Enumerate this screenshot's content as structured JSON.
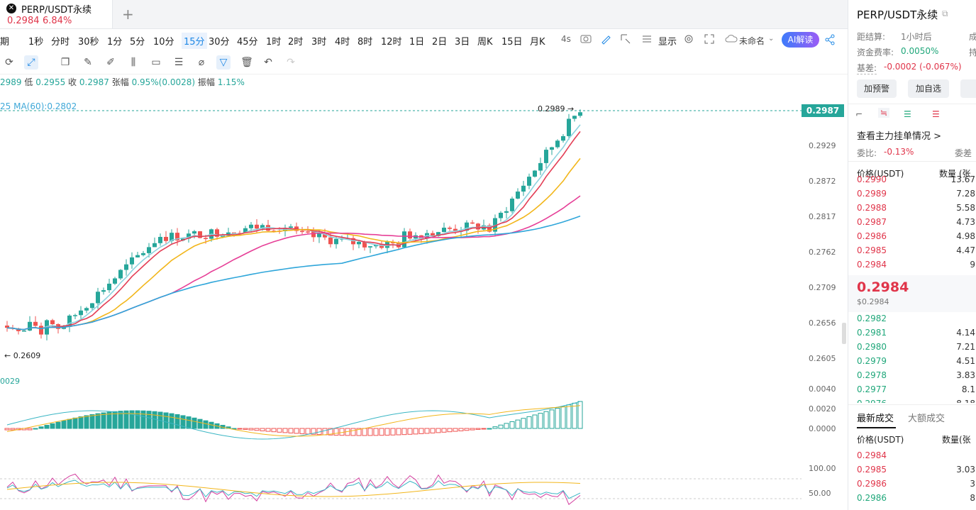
{
  "tab": {
    "symbol": "PERP/USDT永续",
    "price": "0.2984",
    "change": "6.84%"
  },
  "intervals": [
    "期",
    "1秒",
    "分时",
    "30秒",
    "1分",
    "5分",
    "10分",
    "15分",
    "30分",
    "45分",
    "1时",
    "2时",
    "3时",
    "4时",
    "8时",
    "12时",
    "1日",
    "2日",
    "3日",
    "周K",
    "15日",
    "月K",
    "4s"
  ],
  "active_interval": "15分",
  "toolbar_right": {
    "display": "显示",
    "layout": "未命名",
    "ai": "AI解读"
  },
  "ohlc": {
    "high": "2989",
    "low_label": "低",
    "low": "0.2955",
    "close_label": "收",
    "close": "0.2987",
    "amp_label": "张幅",
    "amp": "0.95%(0.0028)",
    "osc_label": "振幅",
    "osc": "1.15%"
  },
  "ma_legend": "25  MA(60):0.2802",
  "annotations": {
    "high": "0.2989",
    "low": "0.2609",
    "macd": "0029"
  },
  "price_axis": [
    "0.2929",
    "0.2872",
    "0.2817",
    "0.2762",
    "0.2709",
    "0.2656",
    "0.2605"
  ],
  "current_price_tag": "0.2987",
  "macd_axis": [
    "0.0040",
    "0.0020",
    "0.0000"
  ],
  "rsi_axis": [
    "100.00",
    "50.00"
  ],
  "colors": {
    "up": "#26a69a",
    "down": "#ef5350",
    "accent": "#1e88e5"
  },
  "sidebar": {
    "symbol": "PERP/USDT永续",
    "settle_label": "距结算:",
    "settle_value": "1小时后",
    "settle_right": "成",
    "fund_label": "资金费率:",
    "fund_value": "0.0050%",
    "fund_right": "持",
    "basis_label": "基差:",
    "basis_value": "-0.0002 (-0.067%)",
    "btn_alert": "加预警",
    "btn_fav": "加自选",
    "depth_link": "查看主力挂单情况 >",
    "ratio_label": "委比:",
    "ratio_value": "-0.13%",
    "ratio_right": "委差",
    "ob_header_price": "价格(USDT)",
    "ob_header_qty": "数量 (张",
    "asks": [
      {
        "p": "0.2990",
        "q": "13.67"
      },
      {
        "p": "0.2989",
        "q": "7.28"
      },
      {
        "p": "0.2988",
        "q": "5.58"
      },
      {
        "p": "0.2987",
        "q": "4.73"
      },
      {
        "p": "0.2986",
        "q": "4.98"
      },
      {
        "p": "0.2985",
        "q": "4.47"
      },
      {
        "p": "0.2984",
        "q": "9"
      }
    ],
    "mid_price": "0.2984",
    "mid_usd": "$0.2984",
    "bids": [
      {
        "p": "0.2982",
        "q": ""
      },
      {
        "p": "0.2981",
        "q": "4.14"
      },
      {
        "p": "0.2980",
        "q": "7.21"
      },
      {
        "p": "0.2979",
        "q": "4.51"
      },
      {
        "p": "0.2978",
        "q": "3.83"
      },
      {
        "p": "0.2977",
        "q": "8.1"
      },
      {
        "p": "0.2976",
        "q": "8.18"
      }
    ],
    "trades_tab1": "最新成交",
    "trades_tab2": "大额成交",
    "trades_header_price": "价格(USDT)",
    "trades_header_qty": "数量(张",
    "trades": [
      {
        "p": "0.2984",
        "q": "",
        "c": "red"
      },
      {
        "p": "0.2985",
        "q": "3.03",
        "c": "red"
      },
      {
        "p": "0.2986",
        "q": "3",
        "c": "red"
      },
      {
        "p": "0.2986",
        "q": "8",
        "c": "green"
      }
    ]
  }
}
